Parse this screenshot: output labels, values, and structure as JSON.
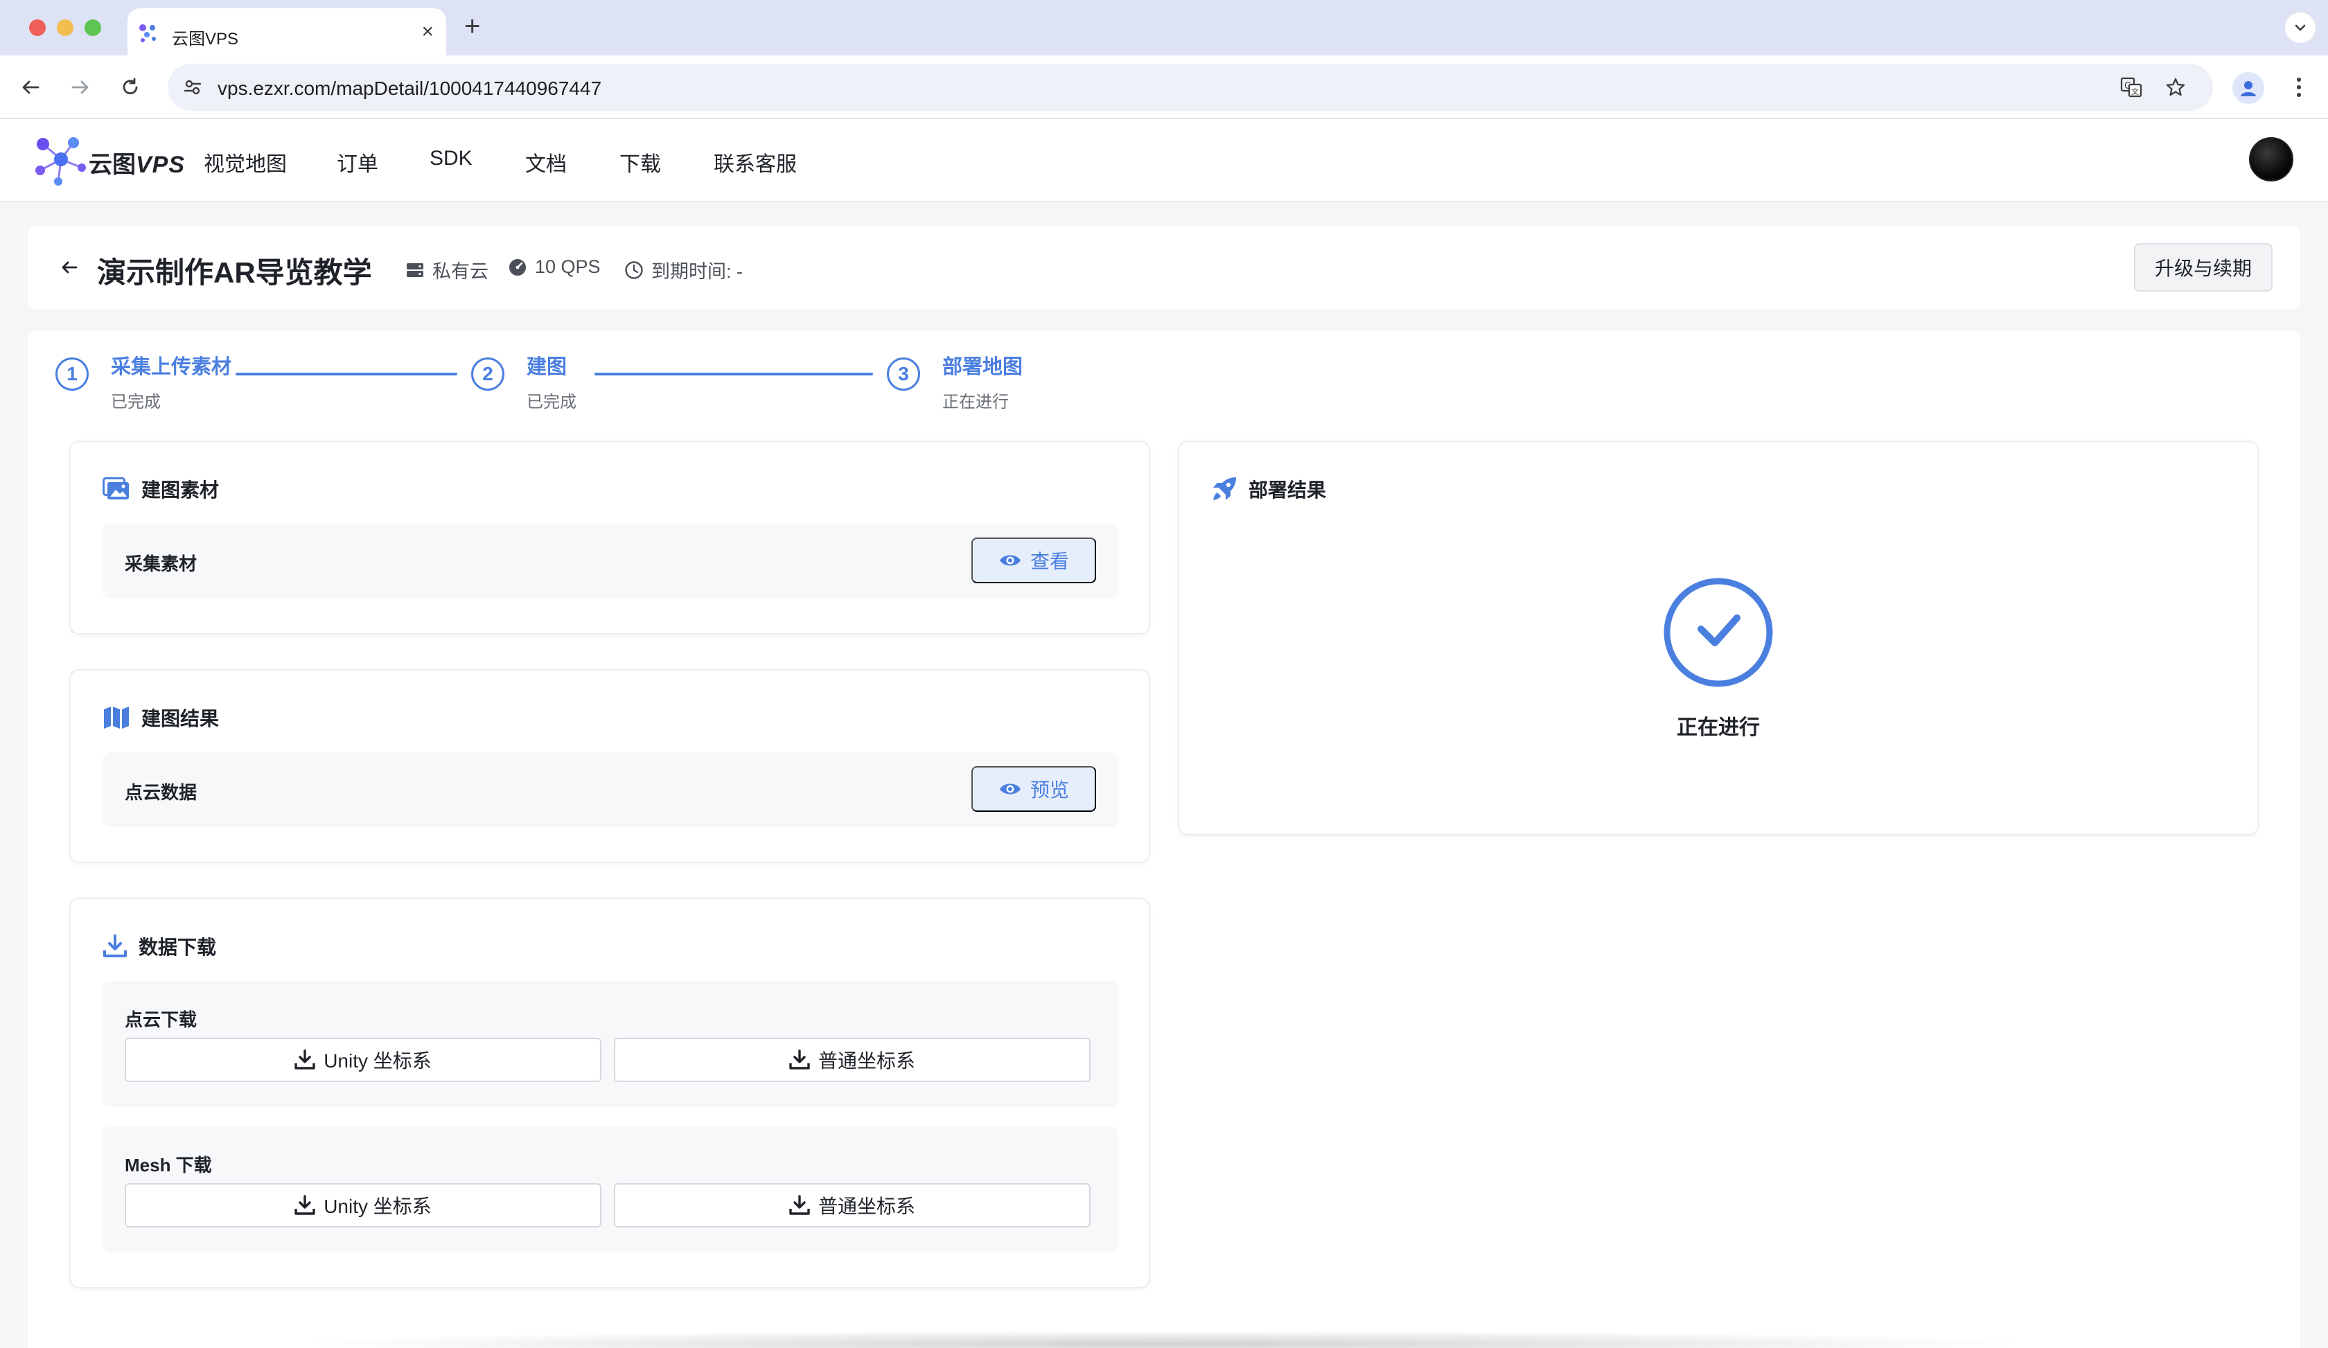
{
  "browser": {
    "tab_title": "云图VPS",
    "url": "vps.ezxr.com/mapDetail/1000417440967447"
  },
  "site": {
    "logo_text_cn": "云图",
    "logo_text_latin": "VPS",
    "nav": [
      "视觉地图",
      "订单",
      "SDK",
      "文档",
      "下载",
      "联系客服"
    ]
  },
  "title_bar": {
    "back_label": "返回",
    "title": "演示制作AR导览教学",
    "cloud_type": "私有云",
    "qps": "10 QPS",
    "expire": "到期时间: -",
    "upgrade_label": "升级与续期"
  },
  "steps": [
    {
      "number": "1",
      "title": "采集上传素材",
      "status": "已完成"
    },
    {
      "number": "2",
      "title": "建图",
      "status": "已完成"
    },
    {
      "number": "3",
      "title": "部署地图",
      "status": "正在进行"
    }
  ],
  "materials": {
    "title": "建图素材",
    "row_label": "采集素材",
    "button": "查看"
  },
  "map_result": {
    "title": "建图结果",
    "row_label": "点云数据",
    "button": "预览"
  },
  "downloads": {
    "title": "数据下载",
    "groups": [
      {
        "label": "点云下载",
        "buttons": [
          "Unity 坐标系",
          "普通坐标系"
        ]
      },
      {
        "label": "Mesh 下载",
        "buttons": [
          "Unity 坐标系",
          "普通坐标系"
        ]
      }
    ]
  },
  "deploy": {
    "title": "部署结果",
    "status": "正在进行"
  },
  "colors": {
    "accent": "#4a7fe0",
    "tab_bar": "#dde3f4",
    "page_bg": "#f5f6f8"
  },
  "icons": {
    "materials": "images-icon",
    "map_result": "map-icon",
    "downloads": "download-icon",
    "deploy": "rocket-icon",
    "status": "check-circle-icon"
  }
}
